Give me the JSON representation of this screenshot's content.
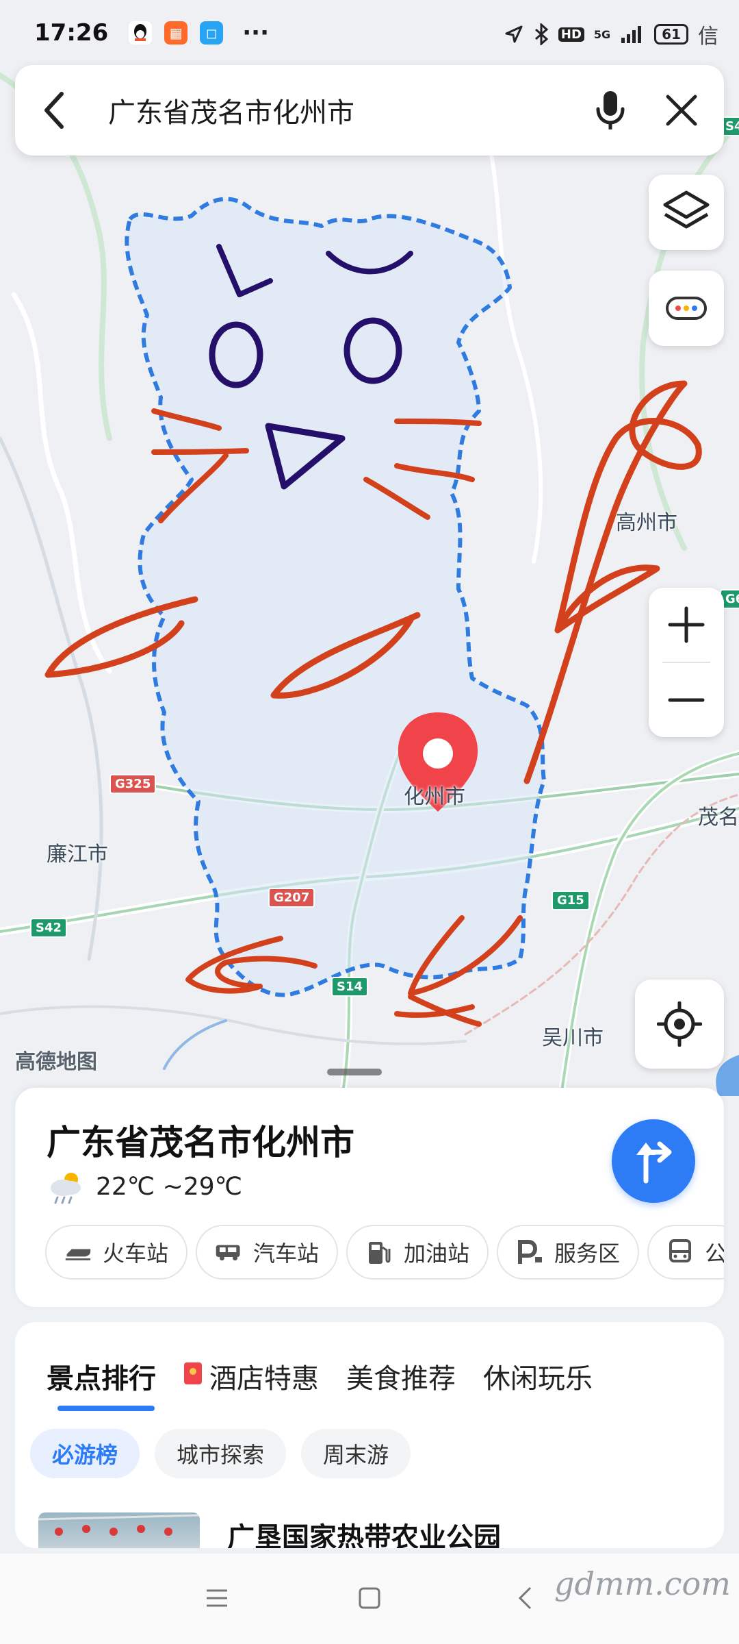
{
  "status_bar": {
    "time": "17:26",
    "network": "5G",
    "hd": "HD",
    "battery": "61",
    "edge_text": "信"
  },
  "search": {
    "query": "广东省茂名市化州市"
  },
  "map": {
    "labels": {
      "gaozhou": "高州市",
      "huazhou": "化州市",
      "lianjiang": "廉江市",
      "wuchuan": "吴川市",
      "maoming": "茂名"
    },
    "roads": [
      "G325",
      "G207",
      "G15",
      "S42",
      "S14",
      "S4",
      "G6"
    ],
    "logo": "高德地图"
  },
  "place_card": {
    "title": "广东省茂名市化州市",
    "weather": "22℃ ~29℃",
    "poi_chips": [
      {
        "label": "火车站",
        "icon": "train-icon"
      },
      {
        "label": "汽车站",
        "icon": "bus-station-icon"
      },
      {
        "label": "加油站",
        "icon": "gas-station-icon"
      },
      {
        "label": "服务区",
        "icon": "parking-service-icon"
      },
      {
        "label": "公",
        "icon": "bus-icon"
      }
    ]
  },
  "recommend": {
    "tabs": [
      {
        "label": "景点排行",
        "active": true
      },
      {
        "label": "酒店特惠",
        "active": false,
        "icon": "red-packet-icon"
      },
      {
        "label": "美食推荐",
        "active": false
      },
      {
        "label": "休闲玩乐",
        "active": false
      }
    ],
    "subtabs": [
      {
        "label": "必游榜",
        "active": true
      },
      {
        "label": "城市探索",
        "active": false
      },
      {
        "label": "周末游",
        "active": false
      }
    ],
    "first_item": "广垦国家热带农业公园"
  },
  "watermark": "gdmm.com",
  "colors": {
    "accent": "#2d7cf6",
    "doodle_red": "#d2401c",
    "doodle_navy": "#24106b",
    "boundary": "#2f7be0",
    "pin": "#f0434a"
  }
}
